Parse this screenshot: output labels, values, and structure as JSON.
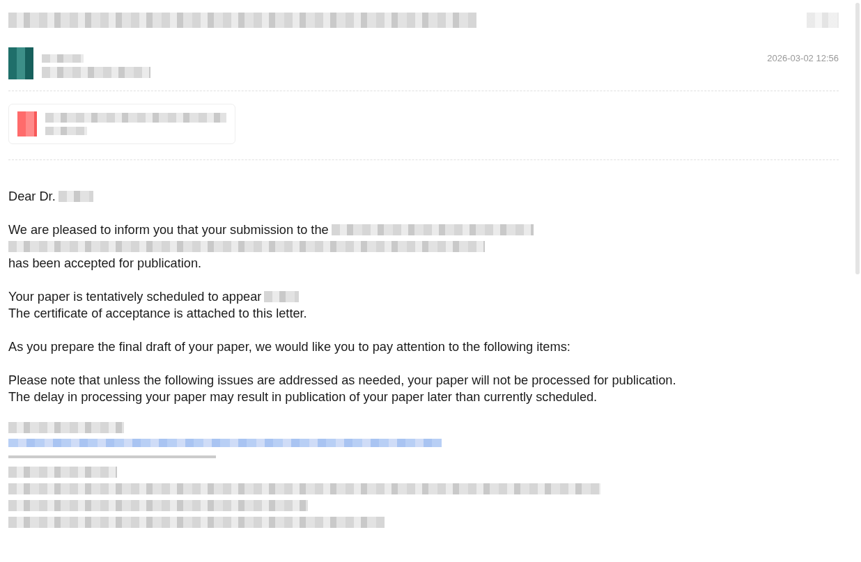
{
  "message": {
    "date": "2026-03-02 12:56"
  },
  "body": [
    [
      {
        "kind": "text",
        "text": "Dear Dr.",
        "redacted_tail": true
      }
    ],
    [
      {
        "kind": "text",
        "text": "We are pleased to inform you that your submission to the",
        "redacted_tail": true
      },
      {
        "kind": "redacted"
      },
      {
        "kind": "text",
        "text": "has been accepted for publication.",
        "redacted_tail": false
      }
    ],
    [
      {
        "kind": "text",
        "text": "Your paper is tentatively scheduled to appear",
        "redacted_tail": true
      },
      {
        "kind": "text",
        "text": "The certificate of acceptance is attached to this letter.",
        "redacted_tail": false
      }
    ],
    [
      {
        "kind": "text",
        "text": "As you prepare the final draft of your paper, we would like you to pay attention to the following items:",
        "redacted_tail": false
      }
    ],
    [
      {
        "kind": "text",
        "text": "Please note that unless the following issues are addressed as needed, your paper will not be processed for publication.",
        "redacted_tail": false
      },
      {
        "kind": "text",
        "text": "The delay in processing your paper may result in publication of your paper later than currently scheduled.",
        "redacted_tail": false
      }
    ]
  ]
}
